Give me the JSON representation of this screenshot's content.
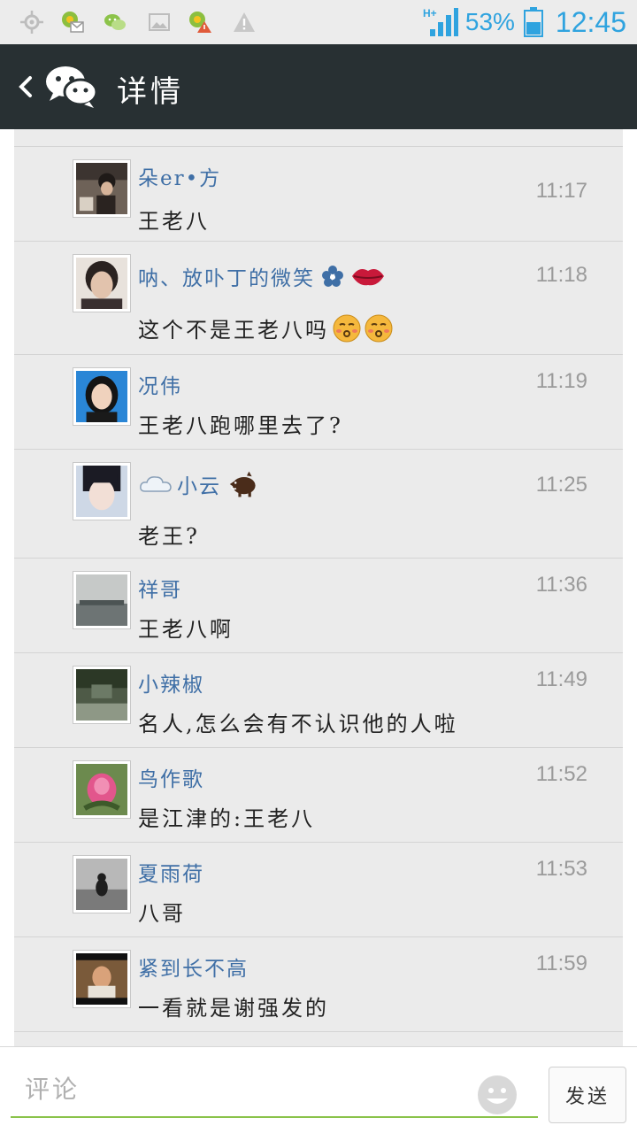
{
  "status_bar": {
    "network": "H+",
    "battery": "53%",
    "time": "12:45"
  },
  "header": {
    "title": "详情"
  },
  "comments": [
    {
      "name": "朵er•方",
      "time": "11:17",
      "text": "王老八"
    },
    {
      "name": "呐、放卟丁的微笑",
      "time": "11:18",
      "text": "这个不是王老八吗"
    },
    {
      "name": "况伟",
      "time": "11:19",
      "text": "王老八跑哪里去了?"
    },
    {
      "name": "小云",
      "time": "11:25",
      "text": "老王?"
    },
    {
      "name": "祥哥",
      "time": "11:36",
      "text": "王老八啊"
    },
    {
      "name": "小辣椒",
      "time": "11:49",
      "text": "名人,怎么会有不认识他的人啦"
    },
    {
      "name": "鸟作歌",
      "time": "11:52",
      "text": "是江津的:王老八"
    },
    {
      "name": "夏雨荷",
      "time": "11:53",
      "text": "八哥"
    },
    {
      "name": "紧到长不高",
      "time": "11:59",
      "text": "一看就是谢强发的"
    }
  ],
  "input": {
    "placeholder": "评论",
    "send_label": "发送"
  },
  "colors": {
    "header_bg": "#283033",
    "accent_blue": "#2fa3df",
    "name_blue": "#3f6fa6",
    "input_underline": "#8ac34a"
  }
}
